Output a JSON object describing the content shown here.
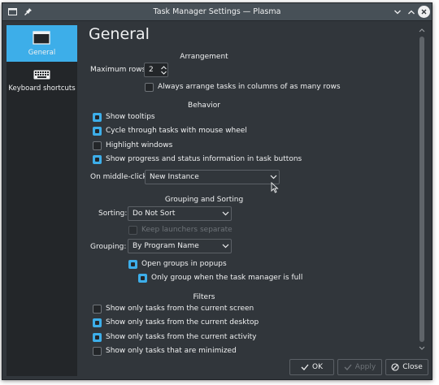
{
  "window": {
    "title": "Task Manager Settings — Plasma"
  },
  "sidebar": {
    "items": [
      {
        "label": "General",
        "icon": "display-icon",
        "active": true
      },
      {
        "label": "Keyboard shortcuts",
        "icon": "keyboard-icon",
        "active": false
      }
    ]
  },
  "page": {
    "title": "General"
  },
  "arrangement": {
    "heading": "Arrangement",
    "max_rows_label": "Maximum rows:",
    "max_rows_value": "2",
    "columns_label": "Always arrange tasks in columns of as many rows",
    "columns_checked": false
  },
  "behavior": {
    "heading": "Behavior",
    "show_tooltips": {
      "label": "Show tooltips",
      "checked": true
    },
    "cycle_wheel": {
      "label": "Cycle through tasks with mouse wheel",
      "checked": true
    },
    "highlight": {
      "label": "Highlight windows",
      "checked": false
    },
    "progress": {
      "label": "Show progress and status information in task buttons",
      "checked": true
    },
    "middle_click_label": "On middle-click:",
    "middle_click_value": "New Instance"
  },
  "grouping": {
    "heading": "Grouping and Sorting",
    "sorting_label": "Sorting:",
    "sorting_value": "Do Not Sort",
    "keep_launchers": {
      "label": "Keep launchers separate",
      "checked": false,
      "enabled": false
    },
    "grouping_label": "Grouping:",
    "grouping_value": "By Program Name",
    "open_popups": {
      "label": "Open groups in popups",
      "checked": true
    },
    "only_full": {
      "label": "Only group when the task manager is full",
      "checked": true
    }
  },
  "filters": {
    "heading": "Filters",
    "current_screen": {
      "label": "Show only tasks from the current screen",
      "checked": false
    },
    "current_desktop": {
      "label": "Show only tasks from the current desktop",
      "checked": true
    },
    "current_activity": {
      "label": "Show only tasks from the current activity",
      "checked": true
    },
    "minimized": {
      "label": "Show only tasks that are minimized",
      "checked": false
    }
  },
  "buttons": {
    "ok": "OK",
    "apply": "Apply",
    "close": "Close"
  },
  "colors": {
    "accent": "#3daee9",
    "window_bg": "#31363b",
    "sidebar_bg": "#232629",
    "titlebar_bg": "#475057"
  }
}
